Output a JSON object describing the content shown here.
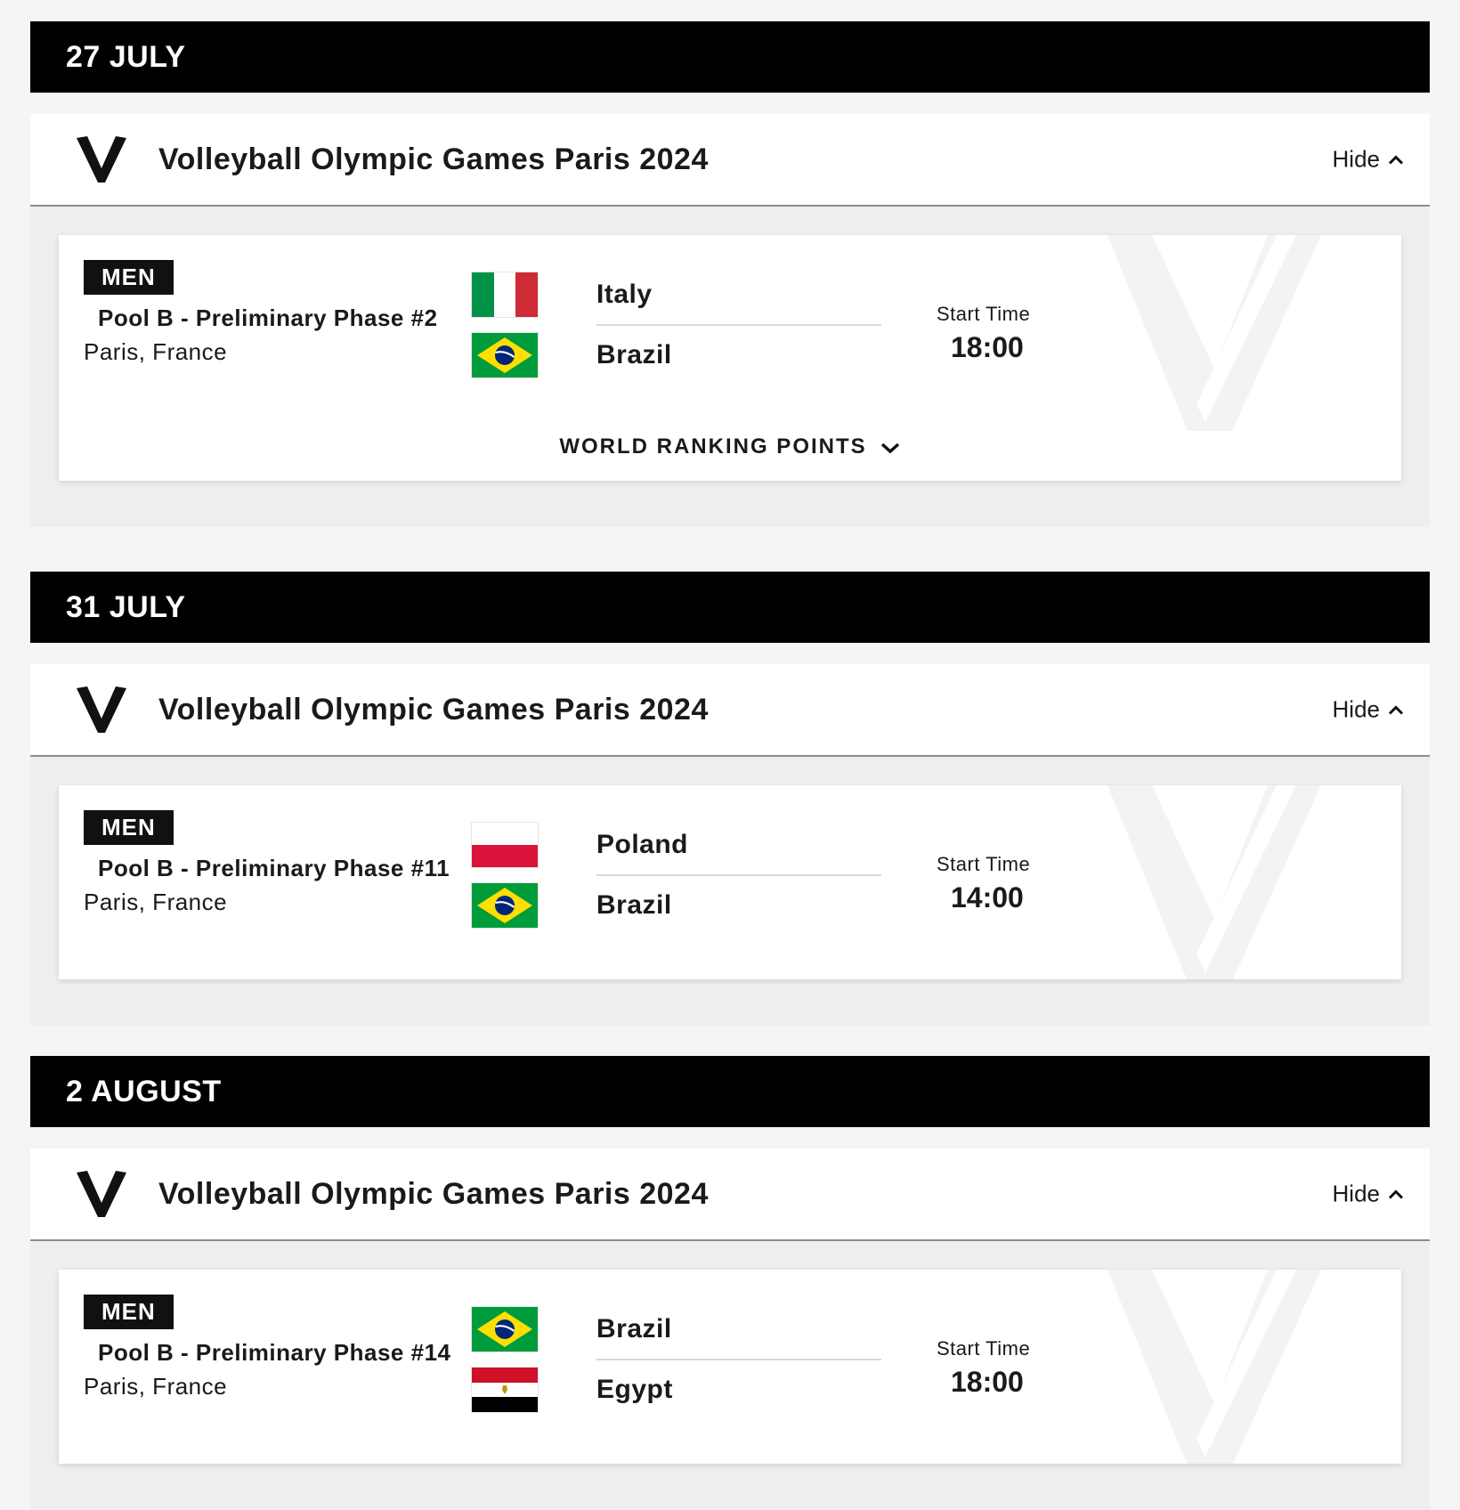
{
  "days": [
    {
      "date": "27 JULY",
      "event": {
        "title": "Volleyball Olympic Games Paris 2024",
        "toggle_label": "Hide",
        "match": {
          "gender": "MEN",
          "phase": "Pool B - Preliminary Phase #2",
          "location": "Paris, France",
          "team1": {
            "name": "Italy",
            "flag": "italy-flag"
          },
          "team2": {
            "name": "Brazil",
            "flag": "brazil-flag"
          },
          "start_label": "Start Time",
          "start_time": "18:00",
          "ranking_label": "WORLD RANKING POINTS"
        }
      }
    },
    {
      "date": "31 JULY",
      "event": {
        "title": "Volleyball Olympic Games Paris 2024",
        "toggle_label": "Hide",
        "match": {
          "gender": "MEN",
          "phase": "Pool B - Preliminary Phase #11",
          "location": "Paris, France",
          "team1": {
            "name": "Poland",
            "flag": "poland-flag"
          },
          "team2": {
            "name": "Brazil",
            "flag": "brazil-flag"
          },
          "start_label": "Start Time",
          "start_time": "14:00"
        }
      }
    },
    {
      "date": "2 AUGUST",
      "event": {
        "title": "Volleyball Olympic Games Paris 2024",
        "toggle_label": "Hide",
        "match": {
          "gender": "MEN",
          "phase": "Pool B - Preliminary Phase #14",
          "location": "Paris, France",
          "team1": {
            "name": "Brazil",
            "flag": "brazil-flag"
          },
          "team2": {
            "name": "Egypt",
            "flag": "egypt-flag"
          },
          "start_label": "Start Time",
          "start_time": "18:00"
        }
      }
    }
  ],
  "colors": {
    "date_bar": "#000000",
    "italy_green": "#009246",
    "italy_red": "#CE2B37",
    "brazil_green": "#009C3B",
    "brazil_yellow": "#FFDF00",
    "brazil_blue": "#002776",
    "poland_red": "#DC143C",
    "egypt_red": "#CE1126",
    "egypt_black": "#000000"
  }
}
